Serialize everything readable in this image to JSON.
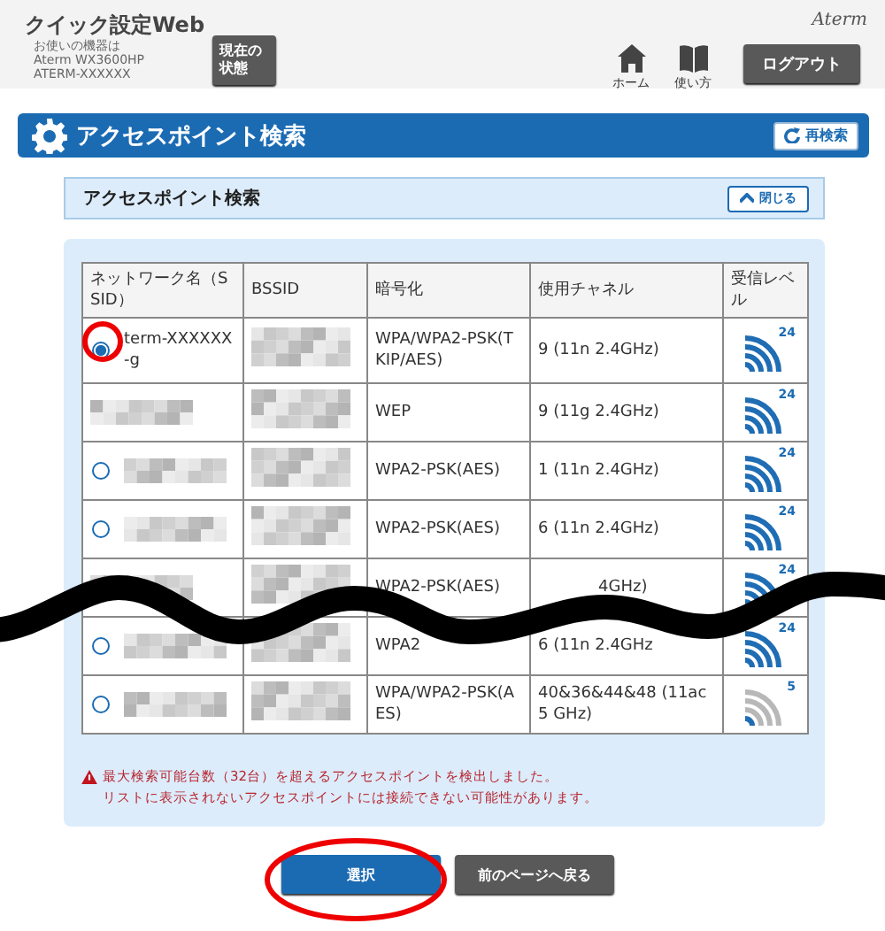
{
  "header": {
    "title": "クイック設定Web",
    "device_lines": [
      "お使いの機器は",
      "Aterm WX3600HP",
      "ATERM-XXXXXX"
    ],
    "status_button": "現在の状態",
    "brand": "Aterm",
    "nav": [
      {
        "kind": "home",
        "label": "ホーム"
      },
      {
        "kind": "book",
        "label": "使い方"
      }
    ],
    "logout_button": "ログアウト"
  },
  "title_bar": {
    "title": "アクセスポイント検索",
    "rescan_button": "再検索"
  },
  "panel": {
    "title": "アクセスポイント検索",
    "close_button": "閉じる"
  },
  "table": {
    "columns": [
      "ネットワーク名（SSID）",
      "BSSID",
      "暗号化",
      "使用チャネル",
      "受信レベル"
    ],
    "rows": [
      {
        "selected": true,
        "ssid": "term-XXXXXX-g",
        "encryption": "WPA/WPA2-PSK(TKIP/AES)",
        "channel": {
          "text": "9 (11n 2.4GHz)",
          "clipped": false
        },
        "band": "24",
        "weak": false
      },
      {
        "encryption": "WEP",
        "channel": {
          "text": "9 (11g 2.4GHz)",
          "clipped": false
        },
        "band": "24",
        "weak": false
      },
      {
        "selected": false,
        "encryption": "WPA2-PSK(AES)",
        "channel": {
          "text": "1 (11n 2.4GHz)",
          "clipped": false
        },
        "band": "24",
        "weak": false
      },
      {
        "selected": false,
        "encryption": "WPA2-PSK(AES)",
        "channel": {
          "text": "6 (11n 2.4GHz)",
          "clipped": false
        },
        "band": "24",
        "weak": false
      },
      {
        "encryption": "WPA2-PSK(AES)",
        "channel": {
          "text": "4GHz)",
          "clipped": true
        },
        "band": "24",
        "weak": false
      },
      {
        "selected": false,
        "encryption": "WPA2",
        "channel": {
          "text": "6 (11n 2.4GHz",
          "clipped": false
        },
        "band": "24",
        "weak": false
      },
      {
        "selected": false,
        "encryption": "WPA/WPA2-PSK(AES)",
        "channel": {
          "text": "40&36&44&48 (11ac 5 GHz)",
          "clipped": false
        },
        "band": "5",
        "weak": true
      }
    ]
  },
  "warning": [
    "最大検索可能台数（32台）を超えるアクセスポイントを検出しました。",
    "リストに表示されないアクセスポイントには接続できない可能性があります。"
  ],
  "buttons": [
    {
      "kind": "primary",
      "label": "選択"
    },
    {
      "kind": "secondary",
      "label": "前のページへ戻る"
    }
  ]
}
